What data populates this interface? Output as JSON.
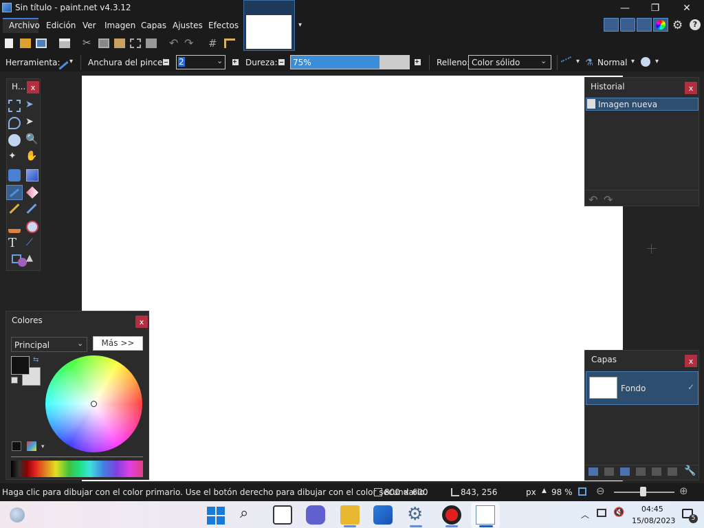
{
  "window": {
    "title": "Sin título - paint.net v4.3.12",
    "minimize": "—",
    "maximize": "❐",
    "close": "✕"
  },
  "menu": {
    "items": [
      "Archivo",
      "Edición",
      "Ver",
      "Imagen",
      "Capas",
      "Ajustes",
      "Efectos"
    ]
  },
  "toolbar": {
    "tool_label": "Herramienta:",
    "brush_width_label": "Anchura del pincel:",
    "brush_width_value": "2",
    "hardness_label": "Dureza:",
    "hardness_value": "75%",
    "hardness_fraction": 0.75,
    "fill_label": "Relleno:",
    "fill_value": "Color sólido",
    "blend_mode": "Normal"
  },
  "tools_panel": {
    "title": "H...",
    "close": "x"
  },
  "history_panel": {
    "title": "Historial",
    "close": "x",
    "items": [
      "Imagen nueva"
    ]
  },
  "colors_panel": {
    "title": "Colores",
    "close": "x",
    "mode": "Principal",
    "more_button": "Más >>"
  },
  "layers_panel": {
    "title": "Capas",
    "close": "x",
    "layers": [
      {
        "name": "Fondo",
        "visible": true
      }
    ]
  },
  "statusbar": {
    "hint": "Haga clic para dibujar con el color primario. Use el botón derecho para dibujar con el color secundario.",
    "image_size": "800 × 600",
    "cursor_pos": "843, 256",
    "units": "px",
    "zoom": "98 %"
  },
  "taskbar": {
    "time": "04:45",
    "date": "15/08/2023",
    "notifications": "5"
  },
  "colors": {
    "accent": "#3a7bd5",
    "panel_bg": "#2b2b2b",
    "selection": "#2e4e6f",
    "close_red": "#b03040"
  }
}
